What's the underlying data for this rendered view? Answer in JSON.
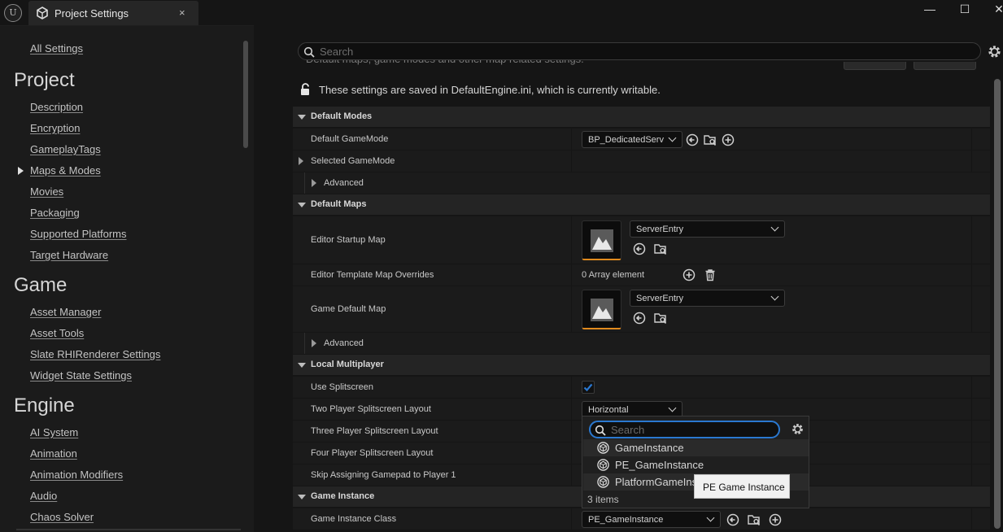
{
  "window": {
    "tab_title": "Project Settings",
    "close_glyph": "×",
    "minimize_glyph": "—",
    "maximize_glyph": "☐",
    "window_close_glyph": "✕"
  },
  "sidebar": {
    "all_settings": "All Settings",
    "project_heading": "Project",
    "project_items": [
      "Description",
      "Encryption",
      "GameplayTags",
      "Maps & Modes",
      "Movies",
      "Packaging",
      "Supported Platforms",
      "Target Hardware"
    ],
    "game_heading": "Game",
    "game_items": [
      "Asset Manager",
      "Asset Tools",
      "Slate RHIRenderer Settings",
      "Widget State Settings"
    ],
    "engine_heading": "Engine",
    "engine_items": [
      "AI System",
      "Animation",
      "Animation Modifiers",
      "Audio",
      "Chaos Solver"
    ]
  },
  "search": {
    "placeholder": "Search"
  },
  "header": {
    "description": "Default maps, game modes and other map related settings.",
    "notice": "These settings are saved in DefaultEngine.ini, which is currently writable."
  },
  "sections": {
    "default_modes": "Default Modes",
    "default_maps": "Default Maps",
    "local_multiplayer": "Local Multiplayer",
    "game_instance": "Game Instance"
  },
  "rows": {
    "default_gamemode": {
      "label": "Default GameMode",
      "value": "BP_DedicatedServ"
    },
    "selected_gamemode": {
      "label": "Selected GameMode"
    },
    "advanced_1": {
      "label": "Advanced"
    },
    "editor_startup_map": {
      "label": "Editor Startup Map",
      "value": "ServerEntry"
    },
    "editor_template_overrides": {
      "label": "Editor Template Map Overrides",
      "value": "0 Array element"
    },
    "game_default_map": {
      "label": "Game Default Map",
      "value": "ServerEntry"
    },
    "advanced_2": {
      "label": "Advanced"
    },
    "use_splitscreen": {
      "label": "Use Splitscreen",
      "checked": true
    },
    "two_player_layout": {
      "label": "Two Player Splitscreen Layout",
      "value": "Horizontal"
    },
    "three_player_layout": {
      "label": "Three Player Splitscreen Layout"
    },
    "four_player_layout": {
      "label": "Four Player Splitscreen Layout"
    },
    "skip_gamepad": {
      "label": "Skip Assigning Gamepad to Player 1"
    },
    "game_instance_class": {
      "label": "Game Instance Class",
      "value": "PE_GameInstance"
    }
  },
  "popup": {
    "search_placeholder": "Search",
    "items": [
      "GameInstance",
      "PE_GameInstance",
      "PlatformGameInstance"
    ],
    "count": "3 items",
    "tooltip": "PE Game Instance"
  },
  "colors": {
    "accent_orange": "#e08a1e",
    "focus_blue": "#2a78d0",
    "check_blue": "#2a78d0"
  }
}
